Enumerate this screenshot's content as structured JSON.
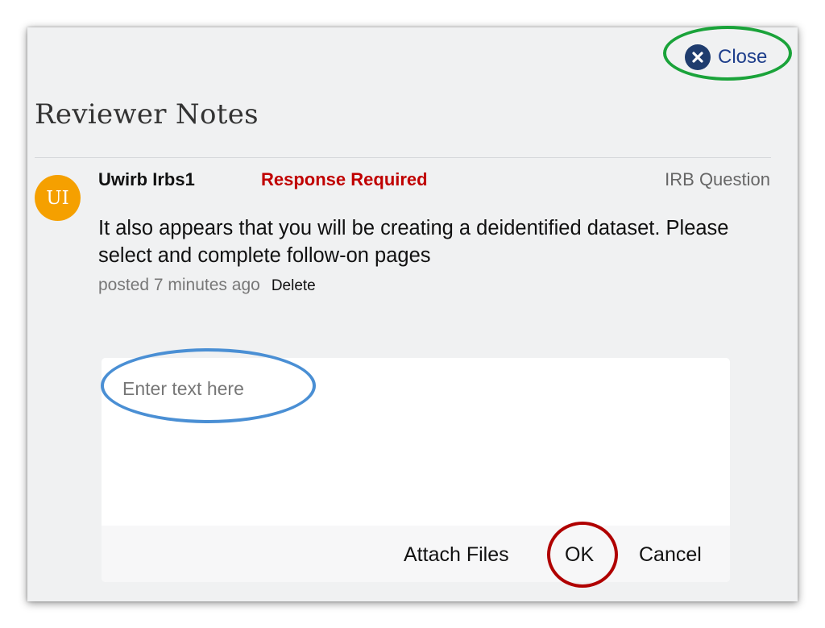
{
  "dialog": {
    "title": "Reviewer Notes",
    "close_label": "Close",
    "close_icon": "close-circle-icon"
  },
  "note": {
    "avatar_initials": "UI",
    "avatar_color": "#f5a000",
    "author": "Uwirb Irbs1",
    "status": "Response Required",
    "status_color": "#c00000",
    "type": "IRB Question",
    "body": "It also appears that you will be creating a deidentified dataset. Please select and complete follow-on pages",
    "posted": "posted 7 minutes ago",
    "delete_label": "Delete"
  },
  "reply": {
    "value": "",
    "placeholder": "Enter text here",
    "attach_label": "Attach Files",
    "ok_label": "OK",
    "cancel_label": "Cancel"
  },
  "annotations": {
    "close_highlight_color": "#1aa33a",
    "input_highlight_color": "#4a8fd4",
    "ok_highlight_color": "#b00000"
  }
}
